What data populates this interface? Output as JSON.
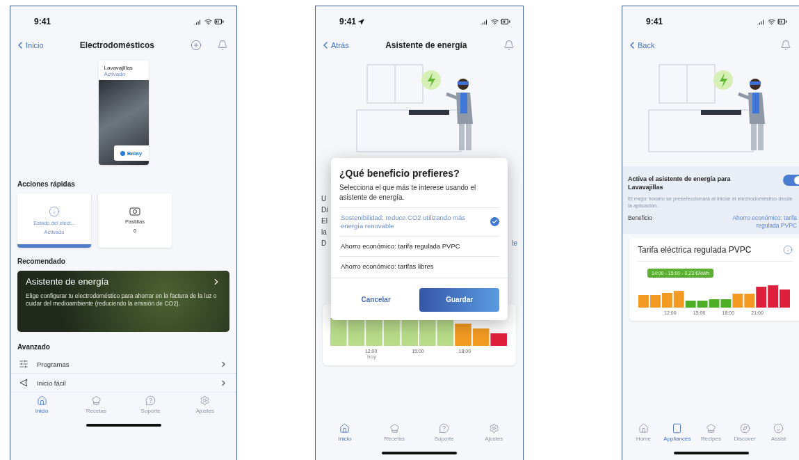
{
  "phone_1": {
    "status_time": "9:41",
    "nav": {
      "back": "Inicio",
      "title": "Electrodomésticos"
    },
    "appliance": {
      "name": "Lavavajillas",
      "status": "Activado",
      "brand": "Balay"
    },
    "quick_actions": {
      "title": "Acciones rápidas",
      "items": [
        {
          "kind": "status",
          "label": "Estado del elect...",
          "value": "Activado",
          "selected": true
        },
        {
          "kind": "pods",
          "label": "Pastillas",
          "value": "0",
          "selected": false
        }
      ]
    },
    "recommended": {
      "title": "Recomendado",
      "card_title": "Asistente de energía",
      "card_text": "Elige configurar tu electrodoméstico para ahorrar en la factura de la luz o cuidar del medioambiente (reduciendo la emisión de CO2)."
    },
    "advanced": {
      "title": "Avanzado",
      "items": [
        {
          "kind": "programs",
          "label": "Programas"
        },
        {
          "kind": "easy-start",
          "label": "Inicio fácil"
        }
      ]
    },
    "tabs": [
      {
        "kind": "home",
        "label": "Inicio",
        "selected": true
      },
      {
        "kind": "recipes",
        "label": "Recetas",
        "selected": false
      },
      {
        "kind": "support",
        "label": "Soporte",
        "selected": false
      },
      {
        "kind": "settings",
        "label": "Ajustes",
        "selected": false
      }
    ]
  },
  "phone_2": {
    "status_time": "9:41",
    "nav": {
      "back": "Atrás",
      "title": "Asistente de energía"
    },
    "background_rows": [
      {
        "left": "U",
        "right": ""
      },
      {
        "left": "Di",
        "right": ""
      },
      {
        "left": "El",
        "right": ""
      },
      {
        "left": "la",
        "right": ""
      },
      {
        "left": "D",
        "right": "le"
      }
    ],
    "dialog": {
      "title": "¿Qué beneficio prefieres?",
      "subtitle": "Selecciona el que más te interese usando el asistente de energía.",
      "options": [
        {
          "label": "Sostenibilidad: reduce CO2 utilizando más energía renovable",
          "selected": true
        },
        {
          "label": "Ahorro económico: tarifa regulada PVPC",
          "selected": false
        },
        {
          "label": "Ahorro económico: tarifas libres",
          "selected": false
        }
      ],
      "cancel": "Cancelar",
      "save": "Guardar"
    },
    "chart": {
      "ticks": [
        "12:00",
        "15:00",
        "18:00"
      ],
      "sublabel": "hoy"
    },
    "tabs": [
      {
        "kind": "home",
        "label": "Inicio",
        "selected": true
      },
      {
        "kind": "recipes",
        "label": "Recetas",
        "selected": false
      },
      {
        "kind": "support",
        "label": "Soporte",
        "selected": false
      },
      {
        "kind": "settings",
        "label": "Ajustes",
        "selected": false
      }
    ]
  },
  "phone_3": {
    "status_time": "9:41",
    "nav": {
      "back": "Back"
    },
    "assistant": {
      "title": "Activa el asistente de energía para Lavavajillas",
      "on": true,
      "description": "El mejor horario se preseleccionará al iniciar el electrodoméstico desde la aplicación.",
      "benefit_label": "Beneficio",
      "benefit_value": "Ahorro económico: tarifa regulada PVPC"
    },
    "tariff_card": {
      "title": "Tarifa eléctrica regulada PVPC",
      "tooltip": "14:00 - 15:00 - 0,23 €/kWh",
      "ticks": [
        "12:00",
        "15:00",
        "18:00",
        "21:00"
      ]
    },
    "tabs": [
      {
        "kind": "home",
        "label": "Home",
        "selected": false
      },
      {
        "kind": "appliances",
        "label": "Appliances",
        "selected": true
      },
      {
        "kind": "recipes",
        "label": "Recipes",
        "selected": false
      },
      {
        "kind": "discover",
        "label": "Discover",
        "selected": false
      },
      {
        "kind": "assist",
        "label": "Assist",
        "selected": false
      }
    ]
  }
}
